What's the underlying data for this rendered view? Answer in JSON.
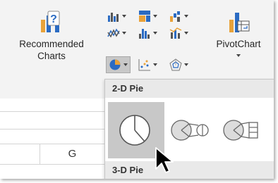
{
  "ribbon": {
    "recommended_charts_label": "Recommended Charts",
    "pivotchart_label": "PivotChart"
  },
  "dropdown": {
    "section_2d": "2-D Pie",
    "section_3d": "3-D Pie"
  },
  "sheet": {
    "column_header": "G"
  },
  "colors": {
    "accent_orange": "#e8a23a",
    "accent_blue": "#2b6bc2",
    "hover_bg": "#c8c8c8"
  }
}
